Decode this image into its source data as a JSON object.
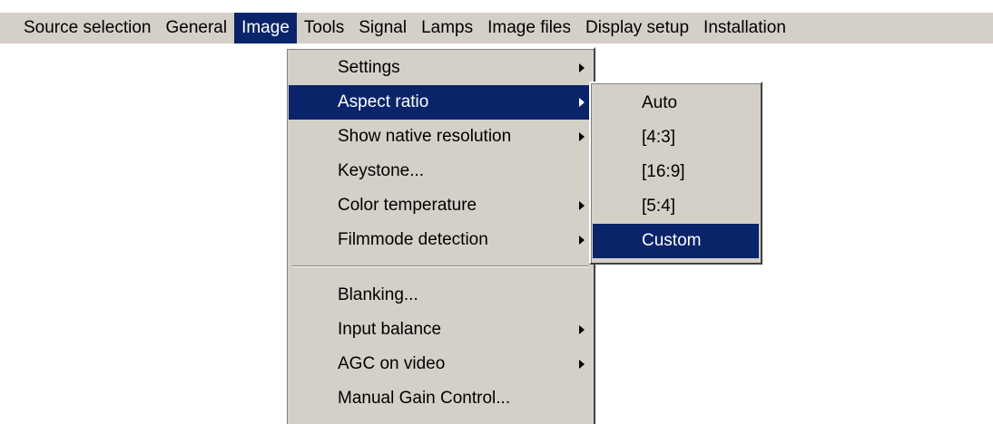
{
  "menubar": {
    "items": [
      {
        "label": "Source selection"
      },
      {
        "label": "General"
      },
      {
        "label": "Image"
      },
      {
        "label": "Tools"
      },
      {
        "label": "Signal"
      },
      {
        "label": "Lamps"
      },
      {
        "label": "Image files"
      },
      {
        "label": "Display setup"
      },
      {
        "label": "Installation"
      }
    ],
    "active": "Image"
  },
  "image_menu": {
    "group1": [
      {
        "label": "Settings",
        "submenu": true
      },
      {
        "label": "Aspect ratio",
        "submenu": true,
        "highlighted": true
      },
      {
        "label": "Show native resolution",
        "submenu": true
      },
      {
        "label": "Keystone...",
        "submenu": false
      },
      {
        "label": "Color temperature",
        "submenu": true
      },
      {
        "label": "Filmmode detection",
        "submenu": true
      }
    ],
    "group2": [
      {
        "label": "Blanking...",
        "submenu": false
      },
      {
        "label": "Input balance",
        "submenu": true
      },
      {
        "label": "AGC on video",
        "submenu": true
      },
      {
        "label": "Manual Gain Control...",
        "submenu": false
      }
    ]
  },
  "aspect_ratio_submenu": {
    "items": [
      {
        "label": "Auto"
      },
      {
        "label": "[4:3]"
      },
      {
        "label": "[16:9]"
      },
      {
        "label": "[5:4]"
      },
      {
        "label": "Custom",
        "highlighted": true
      }
    ]
  },
  "colors": {
    "menu_bg": "#d4d0c8",
    "highlight_bg": "#0a246a",
    "highlight_text": "#ffffff"
  },
  "icons": {
    "submenu_arrow": "submenu-arrow-icon"
  }
}
